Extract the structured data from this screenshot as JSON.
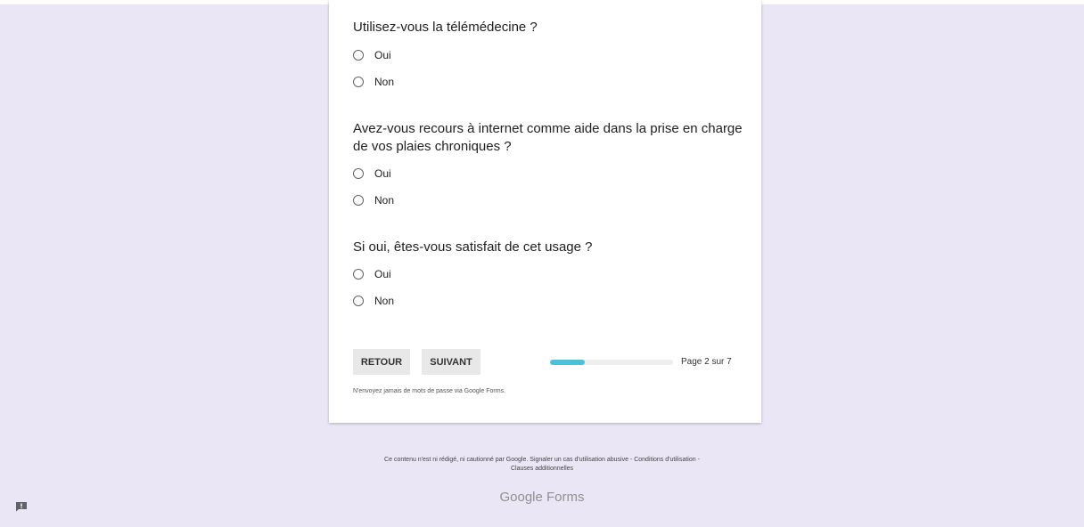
{
  "questions": [
    {
      "title": "Utilisez-vous la télémédecine ?",
      "options": [
        "Oui",
        "Non"
      ]
    },
    {
      "title": "Avez-vous recours à internet comme aide dans la prise en charge de vos plaies chroniques ?",
      "options": [
        "Oui",
        "Non"
      ]
    },
    {
      "title": "Si oui, êtes-vous satisfait de cet usage ?",
      "options": [
        "Oui",
        "Non"
      ]
    }
  ],
  "nav": {
    "back_label": "RETOUR",
    "next_label": "SUIVANT"
  },
  "progress": {
    "label": "Page 2 sur 7",
    "current_page": 2,
    "total_pages": 7,
    "fraction": 0.28
  },
  "note": "N'envoyez jamais de mots de passe via Google Forms.",
  "footer": {
    "disclaimer": "Ce contenu n'est ni rédigé, ni cautionné par Google.",
    "report_link": "Signaler un cas d'utilisation abusive",
    "separator": "-",
    "terms_link": "Conditions d'utilisation",
    "additional_link": "Clauses additionnelles"
  },
  "brand": {
    "google": "Google",
    "forms": "Forms"
  },
  "colors": {
    "background": "#ebe6f5",
    "progress": "#4ac1d8",
    "button_bg": "#e8e8e8"
  },
  "icons": {
    "feedback": "feedback-icon"
  }
}
